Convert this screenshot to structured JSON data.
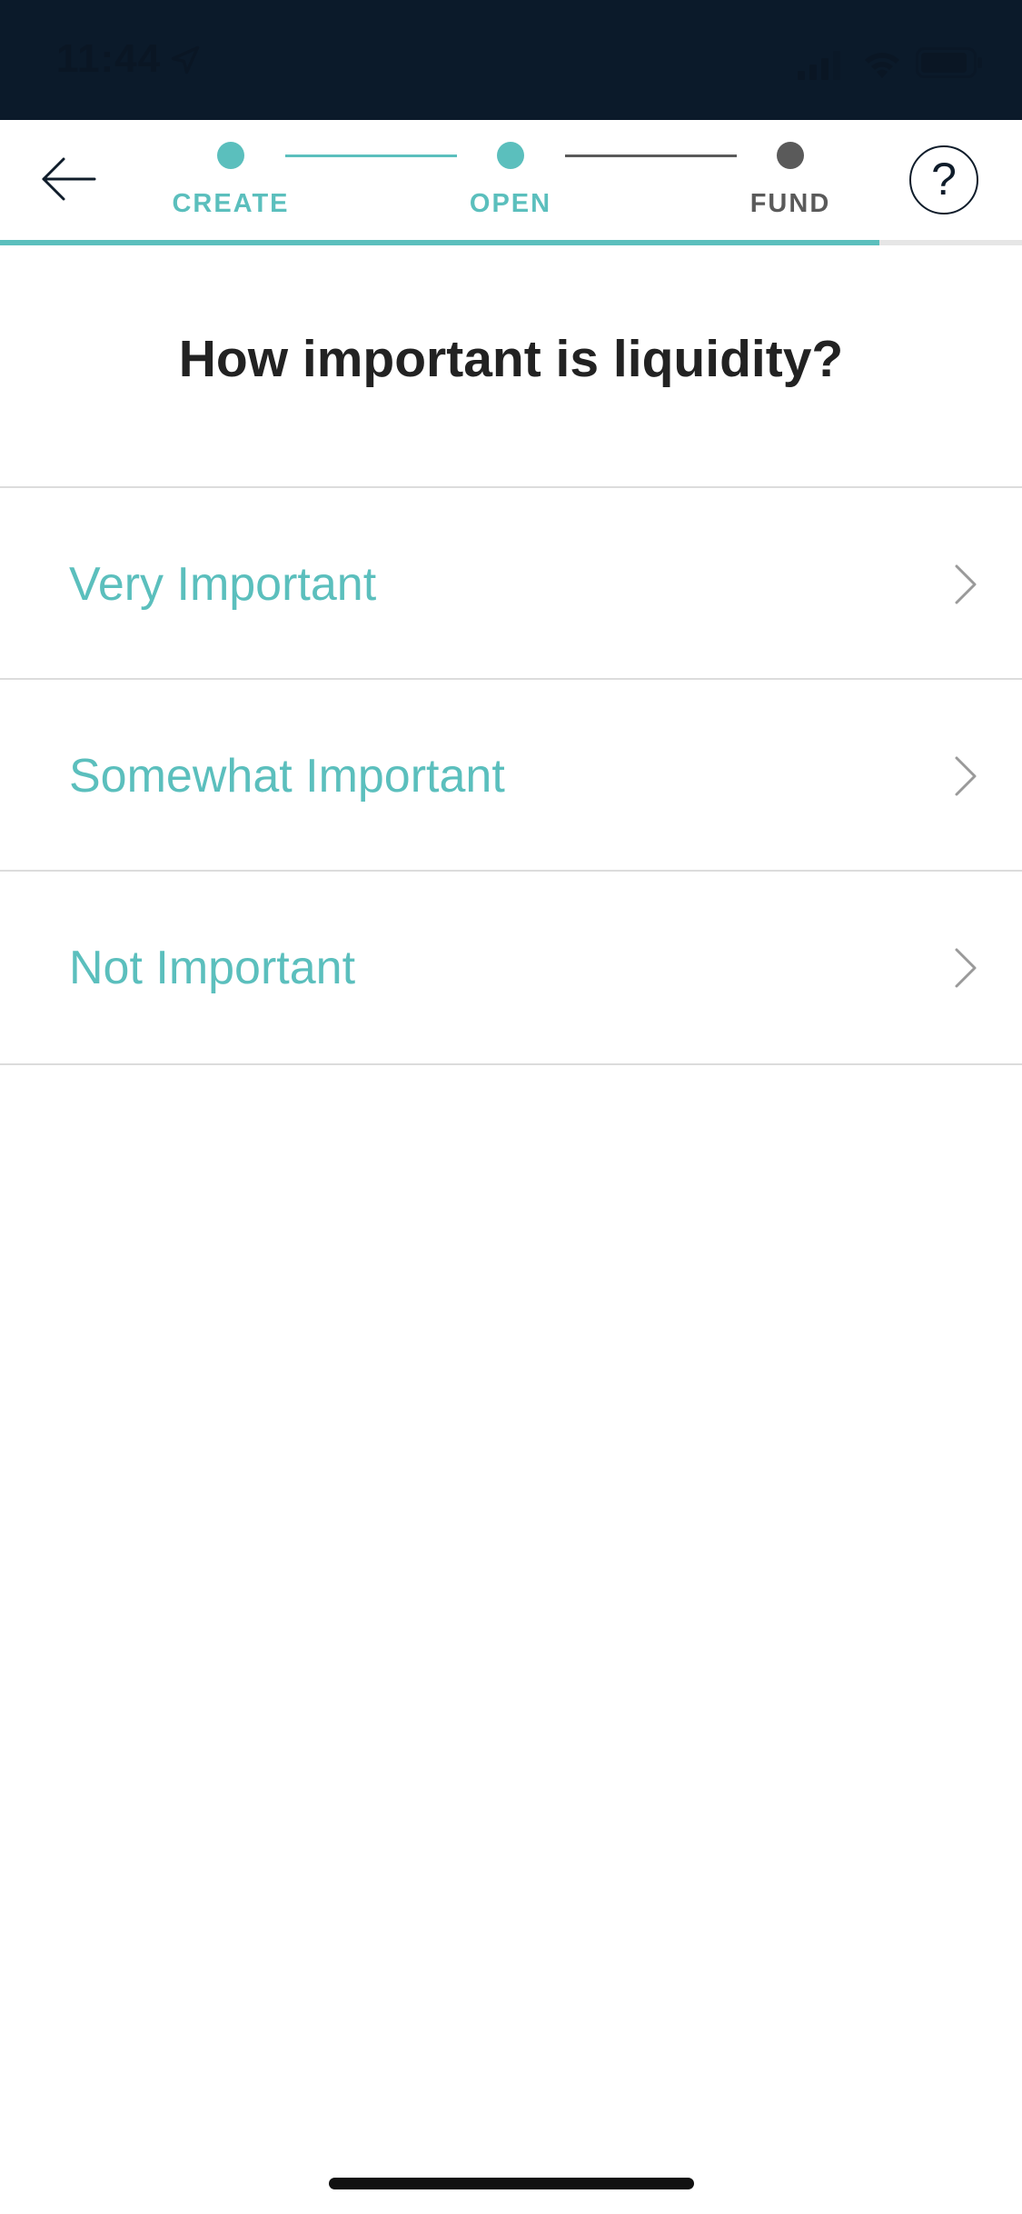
{
  "status_bar": {
    "time": "11:44",
    "location_icon": "location-arrow-icon",
    "signal_icon": "cellular-signal-icon",
    "wifi_icon": "wifi-icon",
    "battery_icon": "battery-icon"
  },
  "header": {
    "back_icon": "arrow-left-icon",
    "help_label": "?",
    "steps": [
      {
        "label": "CREATE",
        "status": "complete"
      },
      {
        "label": "OPEN",
        "status": "current"
      },
      {
        "label": "FUND",
        "status": "upcoming"
      }
    ],
    "progress_fraction": 0.86
  },
  "question": "How important is liquidity?",
  "options": [
    {
      "label": "Very Important"
    },
    {
      "label": "Somewhat Important"
    },
    {
      "label": "Not Important"
    }
  ],
  "colors": {
    "accent": "#5bbfbd",
    "inactive": "#5a5a5a",
    "status_bar_bg": "#0b1a2a",
    "divider": "#dcdcdc"
  }
}
